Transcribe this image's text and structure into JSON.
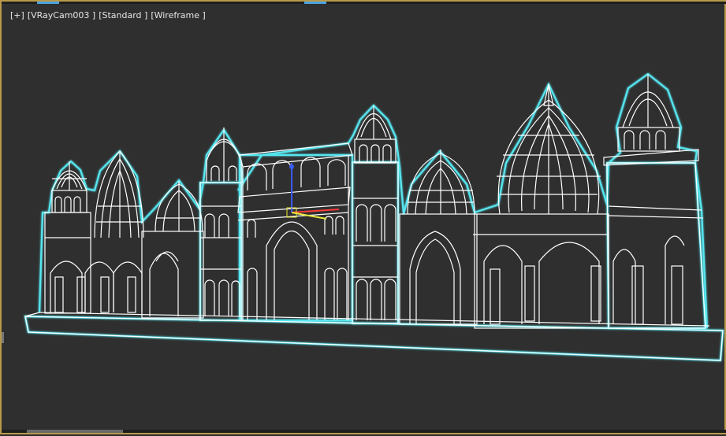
{
  "viewport": {
    "labels": {
      "menu": "[+]",
      "camera": "[VRayCam003 ]",
      "shading": "[Standard ]",
      "mode": "[Wireframe ]"
    }
  },
  "colors": {
    "viewport_bg": "#2f2f2f",
    "wire_primary": "#ffffff",
    "wire_accent": "#56e6f0",
    "active_border": "#b89a4a",
    "gizmo_x": "#ff3b3b",
    "gizmo_y": "#e8e83a",
    "gizmo_z": "#3a5bff"
  },
  "scene": {
    "object_icon": "palace-wireframe-icon",
    "gizmo_icon": "transform-gizmo-icon"
  }
}
